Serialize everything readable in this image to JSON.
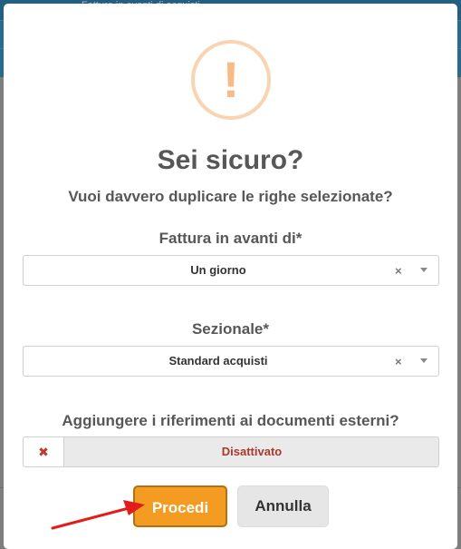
{
  "background": {
    "ghost_text": "Fattura in avanti di acquisti"
  },
  "dialog": {
    "icon": "exclamation-icon",
    "icon_glyph": "!",
    "title": "Sei sicuro?",
    "message": "Vuoi davvero duplicare le righe selezionate?",
    "fields": {
      "forward_label": "Fattura in avanti di*",
      "forward_value": "Un giorno",
      "section_label": "Sezionale*",
      "section_value": "Standard acquisti",
      "external_refs_label": "Aggiungere i riferimenti ai documenti esterni?",
      "external_refs_value": "Disattivato",
      "clear_glyph": "×",
      "toggle_off_glyph": "✖"
    },
    "buttons": {
      "proceed": "Procedi",
      "cancel": "Annulla"
    }
  },
  "colors": {
    "accent": "#f39c21",
    "warning_icon": "#f8bb86",
    "annotation_arrow": "#e21b1b",
    "disabled_text": "#a83a2c"
  }
}
